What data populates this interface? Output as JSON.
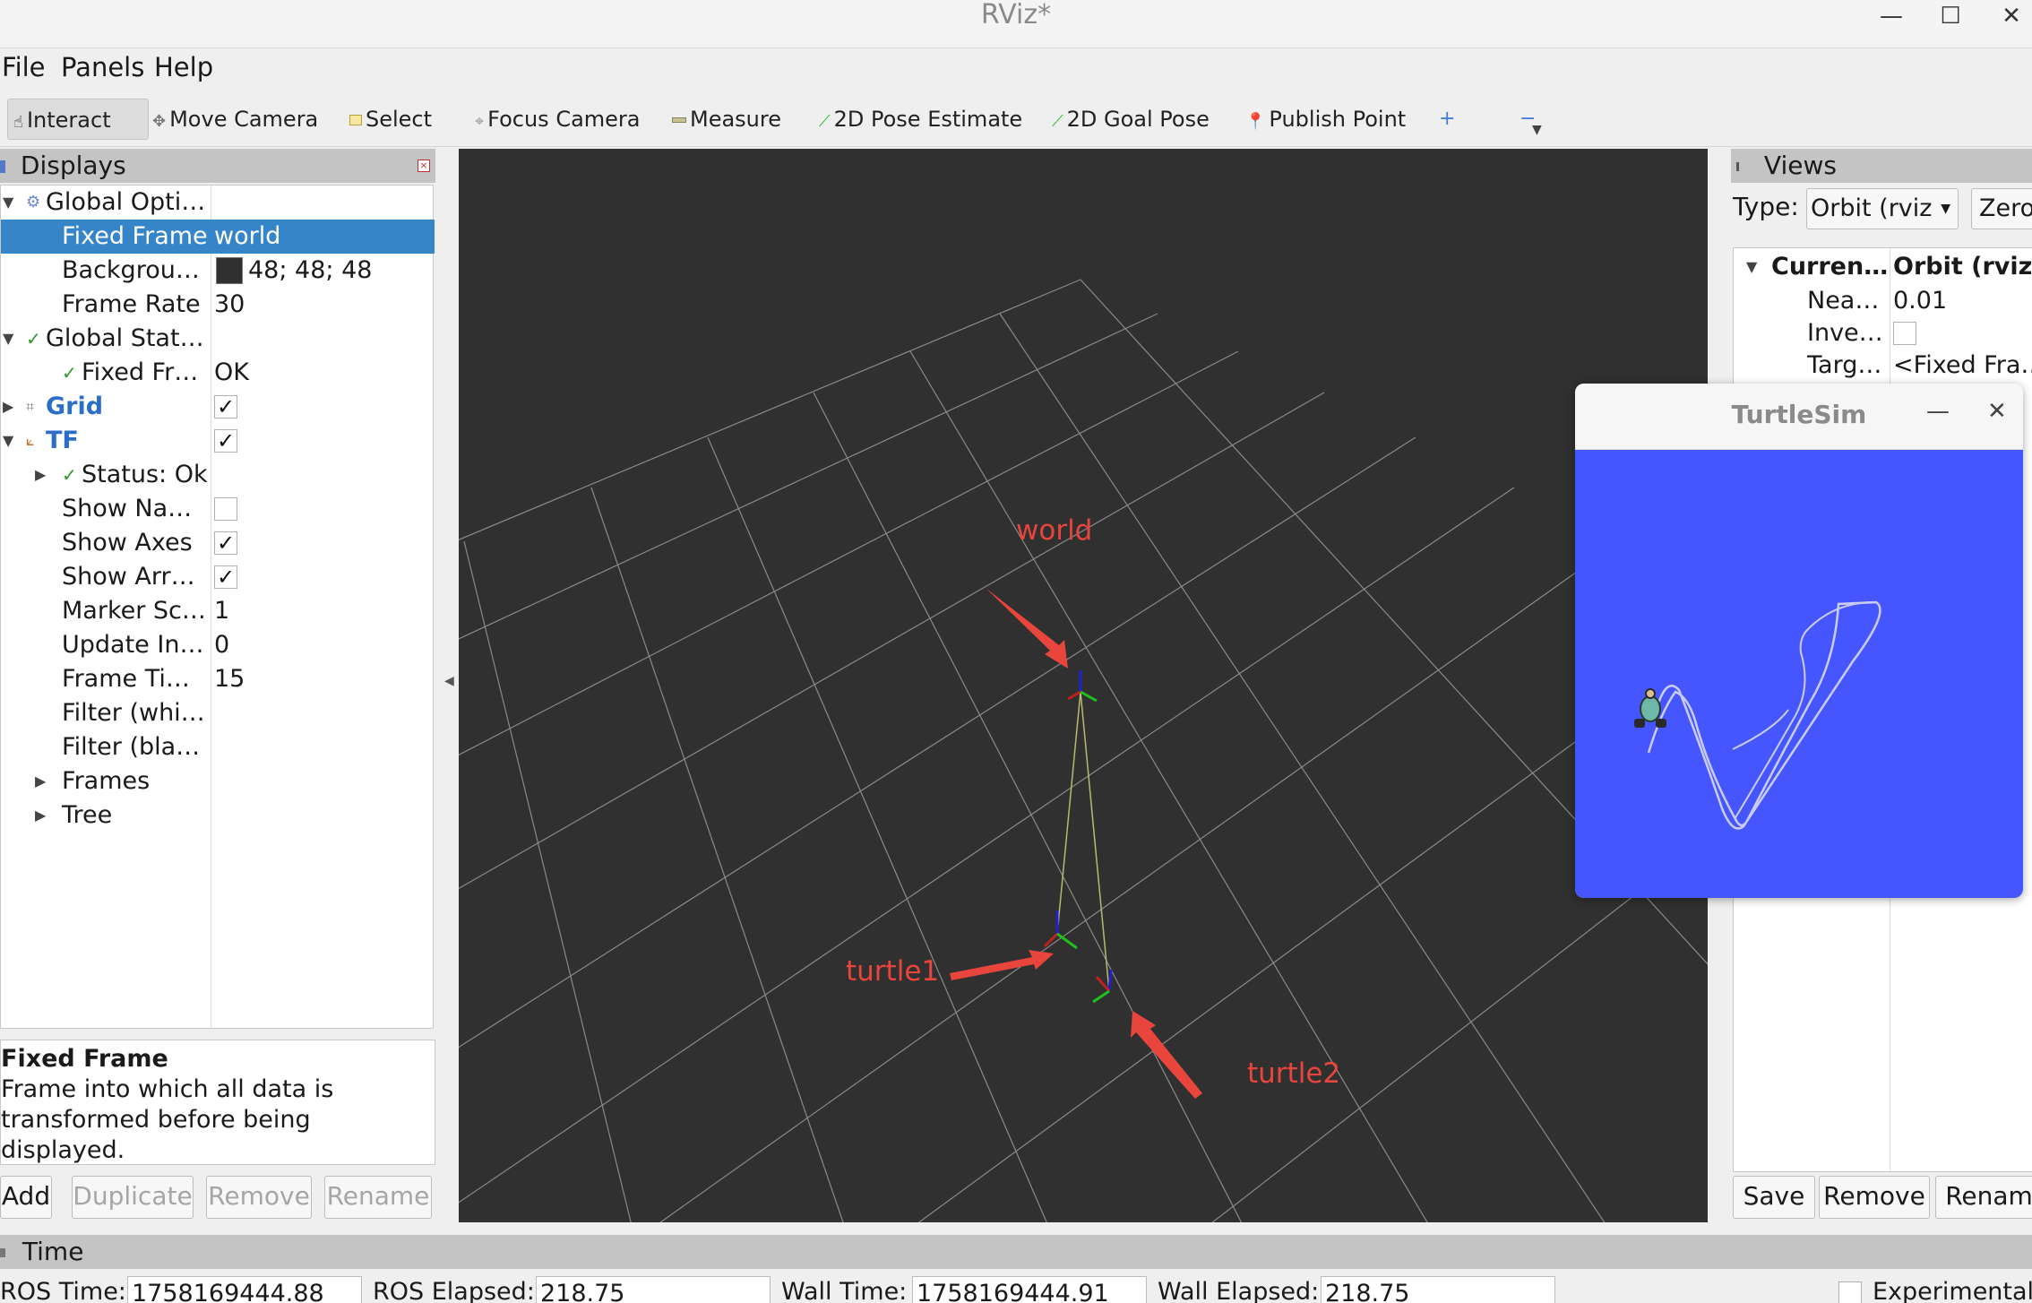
{
  "window": {
    "title": "RViz*",
    "minimize_glyph": "—",
    "maximize_glyph": "☐",
    "close_glyph": "✕"
  },
  "menu": {
    "file": "File",
    "panels": "Panels",
    "help": "Help"
  },
  "toolbar": {
    "interact": "Interact",
    "move_camera": "Move Camera",
    "select": "Select",
    "focus_camera": "Focus Camera",
    "measure": "Measure",
    "pose_estimate": "2D Pose Estimate",
    "goal_pose": "2D Goal Pose",
    "publish_point": "Publish Point"
  },
  "displays": {
    "title": "Displays",
    "rows": {
      "global_options": "Global Opti…",
      "fixed_frame_k": "Fixed Frame",
      "fixed_frame_v": "world",
      "background_k": "Backgrou…",
      "background_v": "48; 48; 48",
      "frame_rate_k": "Frame Rate",
      "frame_rate_v": "30",
      "global_status": "Global Stat…",
      "fixed_fr_k": "Fixed Fr…",
      "fixed_fr_v": "OK",
      "grid": "Grid",
      "tf": "TF",
      "status_ok": "Status: Ok",
      "show_names": "Show Na…",
      "show_axes": "Show Axes",
      "show_arrows": "Show Arr…",
      "marker_scale_k": "Marker Sc…",
      "marker_scale_v": "1",
      "update_interval_k": "Update In…",
      "update_interval_v": "0",
      "frame_timeout_k": "Frame Ti…",
      "frame_timeout_v": "15",
      "filter_white": "Filter (whi…",
      "filter_black": "Filter (bla…",
      "frames": "Frames",
      "tree": "Tree"
    },
    "check_glyph": "✓",
    "background_color": "#303030",
    "description_title": "Fixed Frame",
    "description_line1": "Frame into which all data is",
    "description_line2": "transformed before being displayed.",
    "buttons": {
      "add": "Add",
      "duplicate": "Duplicate",
      "remove": "Remove",
      "rename": "Rename"
    }
  },
  "viewport": {
    "labels": {
      "world": "world",
      "turtle1": "turtle1",
      "turtle2": "turtle2"
    },
    "background": "#303030",
    "annotation_color": "#e8453c"
  },
  "views": {
    "title": "Views",
    "type_label": "Type:",
    "type_value": "Orbit (rviz",
    "zero": "Zero",
    "current_k": "Curren…",
    "current_v": "Orbit (rviz)",
    "near_k": "Nea…",
    "near_v": "0.01",
    "invert_k": "Inve…",
    "target_k": "Targ…",
    "target_v": "<Fixed Fra…",
    "buttons": {
      "save": "Save",
      "remove": "Remove",
      "rename": "Renam"
    }
  },
  "turtlesim": {
    "title": "TurtleSim",
    "bg_color": "#4556ff"
  },
  "time": {
    "title": "Time",
    "ros_time_label": "ROS Time:",
    "ros_time": "1758169444.88",
    "ros_elapsed_label": "ROS Elapsed:",
    "ros_elapsed": "218.75",
    "wall_time_label": "Wall Time:",
    "wall_time": "1758169444.91",
    "wall_elapsed_label": "Wall Elapsed:",
    "wall_elapsed": "218.75",
    "experimental": "Experimental"
  }
}
